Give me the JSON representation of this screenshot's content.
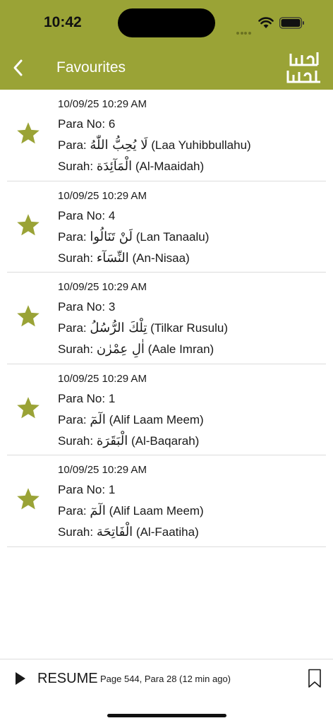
{
  "status": {
    "time": "10:42"
  },
  "header": {
    "title": "Favourites",
    "logo_text": "القرآن الكريم"
  },
  "colors": {
    "accent": "#9aa336",
    "star": "#9aa336"
  },
  "list_labels": {
    "para_no": "Para No:",
    "para": "Para:",
    "surah": "Surah:"
  },
  "items": [
    {
      "date": "10/09/25 10:29 AM",
      "para_no": "6",
      "para_ar": "لَا يُحِبُّ اللّٰهُ",
      "para_en": "(Laa Yuhibbullahu)",
      "surah_ar": "الْمَآئِدَة",
      "surah_en": "(Al-Maaidah)"
    },
    {
      "date": "10/09/25 10:29 AM",
      "para_no": "4",
      "para_ar": "لَنْ تَنَالُوا",
      "para_en": "(Lan Tanaalu)",
      "surah_ar": "النِّسَآء",
      "surah_en": "(An-Nisaa)"
    },
    {
      "date": "10/09/25 10:29 AM",
      "para_no": "3",
      "para_ar": "تِلْكَ الرُّسُلُ",
      "para_en": "(Tilkar Rusulu)",
      "surah_ar": "اٰلِ عِمْرٰن",
      "surah_en": "(Aale Imran)"
    },
    {
      "date": "10/09/25 10:29 AM",
      "para_no": "1",
      "para_ar": "الٓمٓ",
      "para_en": "(Alif Laam Meem)",
      "surah_ar": "الْبَقَرَة",
      "surah_en": "(Al-Baqarah)"
    },
    {
      "date": "10/09/25 10:29 AM",
      "para_no": "1",
      "para_ar": "الٓمٓ",
      "para_en": "(Alif Laam Meem)",
      "surah_ar": "الْفَاتِحَة",
      "surah_en": "(Al-Faatiha)"
    }
  ],
  "bottom": {
    "resume_label": "RESUME",
    "resume_info": "Page 544, Para 28 (12 min ago)"
  },
  "icons": [
    "back-icon",
    "logo",
    "star-icon",
    "play-icon",
    "bookmark-icon",
    "wifi-icon",
    "battery-icon"
  ]
}
